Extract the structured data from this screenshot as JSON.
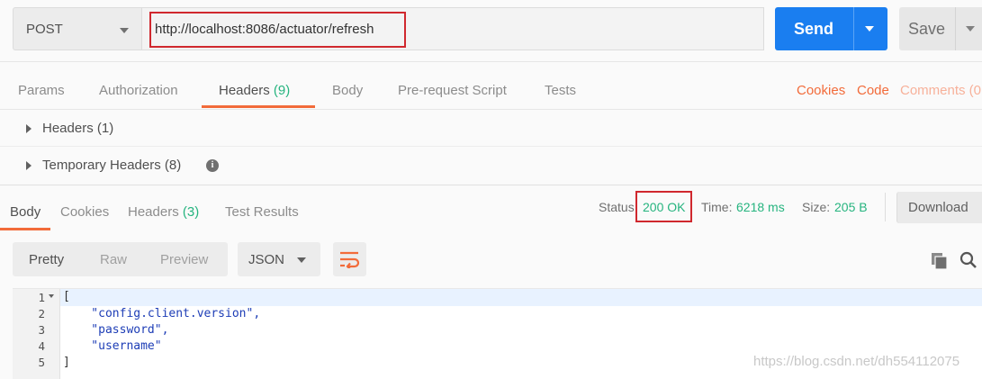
{
  "request": {
    "method": "POST",
    "url": "http://localhost:8086/actuator/refresh",
    "send_label": "Send",
    "save_label": "Save"
  },
  "request_tabs": [
    {
      "label": "Params"
    },
    {
      "label": "Authorization"
    },
    {
      "label": "Headers",
      "count": "(9)"
    },
    {
      "label": "Body"
    },
    {
      "label": "Pre-request Script"
    },
    {
      "label": "Tests"
    }
  ],
  "request_links": {
    "cookies": "Cookies",
    "code": "Code",
    "comments": "Comments (0"
  },
  "header_sections": [
    {
      "label": "Headers (1)"
    },
    {
      "label": "Temporary Headers (8)"
    }
  ],
  "response_tabs": [
    {
      "label": "Body"
    },
    {
      "label": "Cookies"
    },
    {
      "label": "Headers",
      "count": "(3)"
    },
    {
      "label": "Test Results"
    }
  ],
  "response_meta": {
    "status_label": "Status:",
    "status_value": "200 OK",
    "time_label": "Time:",
    "time_value": "6218 ms",
    "size_label": "Size:",
    "size_value": "205 B",
    "download_label": "Download"
  },
  "body_view": {
    "modes": [
      "Pretty",
      "Raw",
      "Preview"
    ],
    "format": "JSON"
  },
  "code_lines": [
    {
      "num": "1",
      "text": "["
    },
    {
      "num": "2",
      "text": "    \"config.client.version\","
    },
    {
      "num": "3",
      "text": "    \"password\","
    },
    {
      "num": "4",
      "text": "    \"username\""
    },
    {
      "num": "5",
      "text": "]"
    }
  ],
  "watermark": "https://blog.csdn.net/dh554112075",
  "colors": {
    "accent": "#f26b3a",
    "send": "#1a7ef0",
    "success": "#26b47f",
    "highlight": "#d0282e"
  }
}
